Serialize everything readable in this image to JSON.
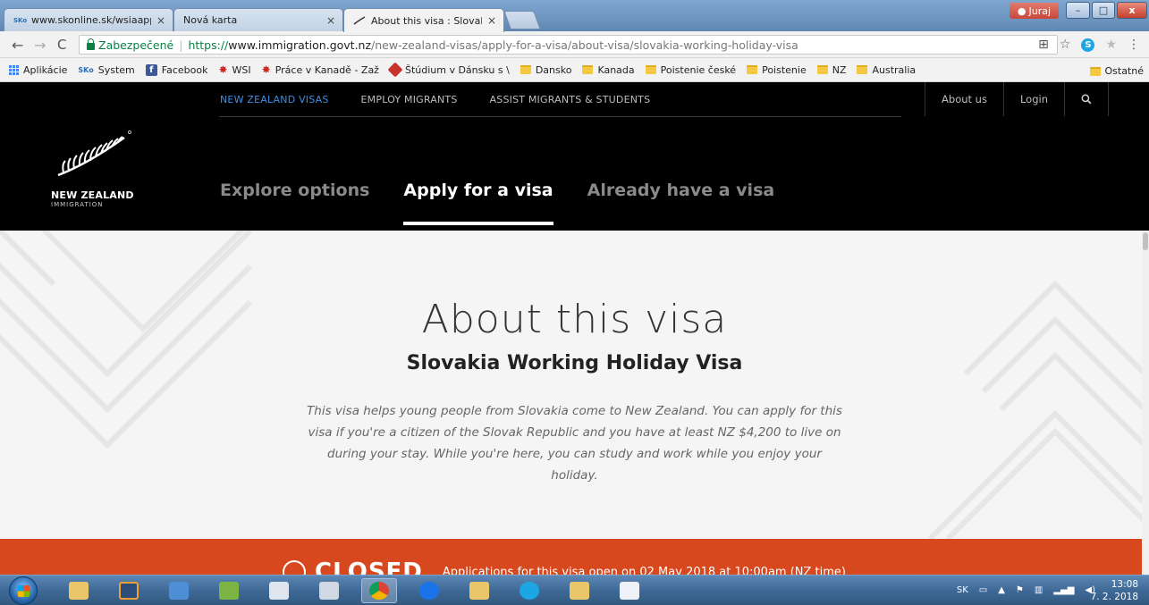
{
  "browser": {
    "tabs": [
      {
        "label": "www.skonline.sk/wsiaapp",
        "favicon": "sko-icon",
        "active": false
      },
      {
        "label": "Nová karta",
        "favicon": "",
        "active": false
      },
      {
        "label": "About this visa : Slovakia",
        "favicon": "fern-icon",
        "active": true
      }
    ],
    "tab_close_glyph": "×",
    "user_chip": "Juraj",
    "window_buttons": {
      "minimize": "–",
      "maximize": "□",
      "close": "x"
    },
    "address": {
      "secure_label": "Zabezpečené",
      "scheme": "https://",
      "host": "www.immigration.govt.nz",
      "path": "/new-zealand-visas/apply-for-a-visa/about-visa/slovakia-working-holiday-visa"
    },
    "bookmarks": [
      {
        "label": "Aplikácie",
        "icon": "apps-icon"
      },
      {
        "label": "System",
        "icon": "sko-icon"
      },
      {
        "label": "Facebook",
        "icon": "facebook-icon"
      },
      {
        "label": "WSI",
        "icon": "maple-leaf-icon"
      },
      {
        "label": "Práce v Kanadě - Zaž",
        "icon": "maple-leaf-icon"
      },
      {
        "label": "Štúdium v Dánsku s \\",
        "icon": "studium-icon"
      },
      {
        "label": "Dansko",
        "icon": "folder-icon"
      },
      {
        "label": "Kanada",
        "icon": "folder-icon"
      },
      {
        "label": "Poistenie české",
        "icon": "folder-icon"
      },
      {
        "label": "Poistenie",
        "icon": "folder-icon"
      },
      {
        "label": "NZ",
        "icon": "folder-icon"
      },
      {
        "label": "Australia",
        "icon": "folder-icon"
      }
    ],
    "other_bookmarks": "Ostatné"
  },
  "site": {
    "topnav": [
      {
        "label": "NEW ZEALAND VISAS",
        "active": true
      },
      {
        "label": "EMPLOY MIGRANTS",
        "active": false
      },
      {
        "label": "ASSIST MIGRANTS & STUDENTS",
        "active": false
      }
    ],
    "about_us": "About us",
    "login": "Login",
    "logo": {
      "title": "NEW ZEALAND",
      "subtitle": "IMMIGRATION"
    },
    "mainnav": [
      {
        "label": "Explore options",
        "active": false
      },
      {
        "label": "Apply for a visa",
        "active": true
      },
      {
        "label": "Already have a visa",
        "active": false
      }
    ],
    "hero": {
      "title": "About this visa",
      "subtitle": "Slovakia Working Holiday Visa",
      "description": "This visa helps young people from Slovakia come to New Zealand. You can apply for this visa if you're a citizen of the Slovak Republic and you have at least NZ $4,200 to live on during your stay. While you're here, you can study and work while you enjoy your holiday."
    },
    "status": {
      "word": "CLOSED",
      "message": "Applications for this visa open on 02 May 2018 at 10:00am (NZ time)"
    }
  },
  "taskbar": {
    "language": "SK",
    "time": "13:08",
    "date": "7. 2. 2018"
  },
  "colors": {
    "accent_blue": "#3d8ee0",
    "closed_orange": "#d8481e",
    "secure_green": "#0b8043"
  }
}
